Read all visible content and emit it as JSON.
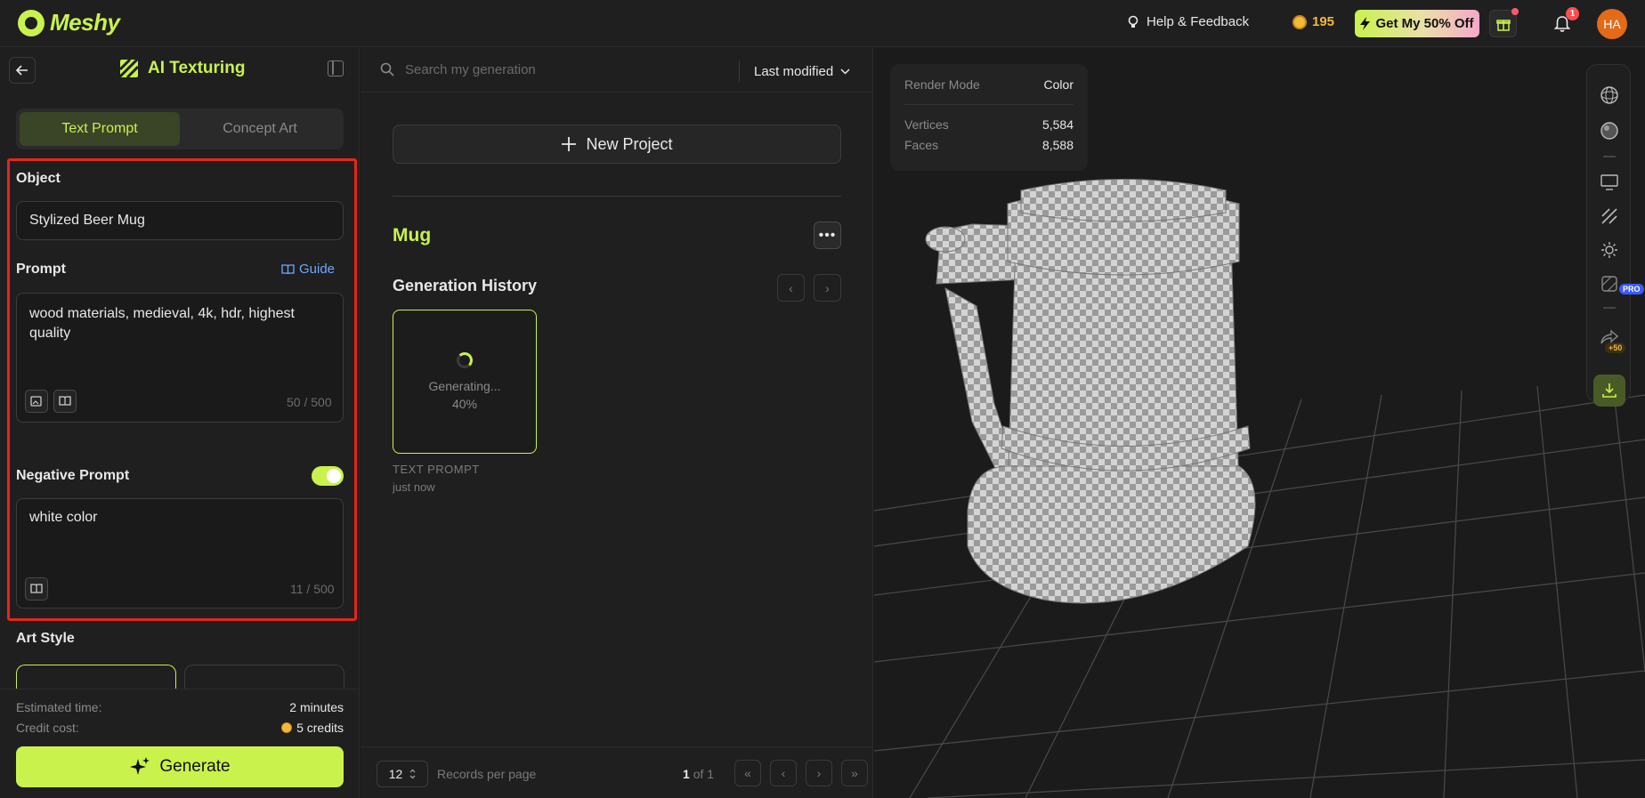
{
  "app": {
    "name": "Meshy"
  },
  "topbar": {
    "help_label": "Help & Feedback",
    "credits": "195",
    "promo_label": "Get My 50% Off",
    "notification_count": "1",
    "avatar_initials": "HA"
  },
  "panel": {
    "title": "AI Texturing",
    "tabs": [
      {
        "label": "Text Prompt",
        "active": true
      },
      {
        "label": "Concept Art",
        "active": false
      }
    ],
    "object": {
      "label": "Object",
      "value": "Stylized Beer Mug"
    },
    "prompt": {
      "label": "Prompt",
      "guide_label": "Guide",
      "value": "wood materials, medieval, 4k, hdr, highest quality",
      "count": "50 / 500"
    },
    "negative_prompt": {
      "label": "Negative Prompt",
      "enabled": true,
      "value": "white color",
      "count": "11 / 500"
    },
    "art_style_label": "Art Style",
    "estimated_time_label": "Estimated time:",
    "estimated_time_value": "2 minutes",
    "credit_cost_label": "Credit cost:",
    "credit_cost_value": "5 credits",
    "generate_label": "Generate"
  },
  "library": {
    "search_placeholder": "Search my generation",
    "sort_label": "Last modified",
    "new_project_label": "New Project",
    "project_name": "Mug",
    "history_title": "Generation History",
    "card": {
      "status": "Generating...",
      "progress": "40%",
      "type": "TEXT PROMPT",
      "time": "just now"
    },
    "per_page_value": "12",
    "per_page_label": "Records per page",
    "page_current": "1",
    "page_total": "of 1"
  },
  "viewer": {
    "stats": [
      {
        "key": "Render Mode",
        "value": "Color"
      },
      {
        "key": "Vertices",
        "value": "5,584"
      },
      {
        "key": "Faces",
        "value": "8,588"
      }
    ],
    "pro_tag": "PRO",
    "share_reward": "+50"
  },
  "colors": {
    "accent": "#c9f24d",
    "highlight_box": "#e8241c",
    "link": "#6ea8ff",
    "coin": "#f5b93a"
  }
}
